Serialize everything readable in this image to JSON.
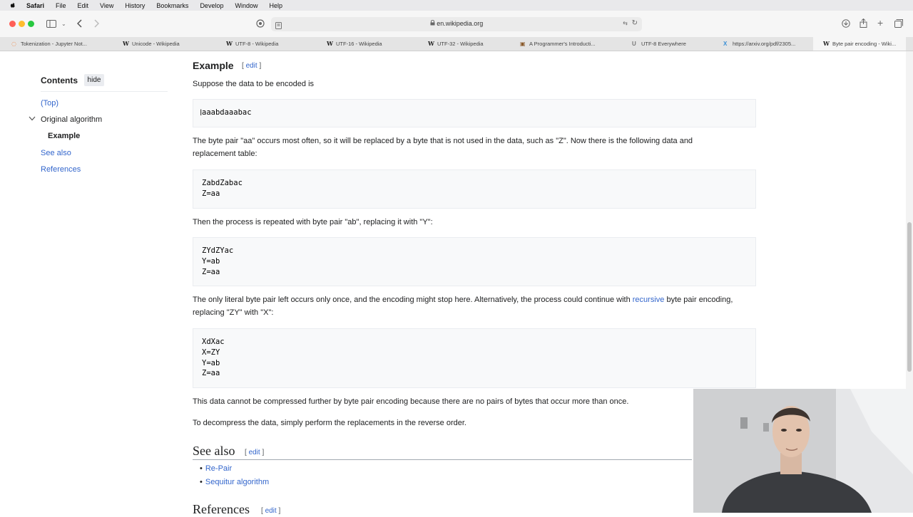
{
  "menubar": {
    "app": "Safari",
    "items": [
      "File",
      "Edit",
      "View",
      "History",
      "Bookmarks",
      "Develop",
      "Window",
      "Help"
    ]
  },
  "toolbar": {
    "address": "en.wikipedia.org"
  },
  "tabs": [
    {
      "label": "Tokenization - Jupyter Not...",
      "icon": "jupyter-icon"
    },
    {
      "label": "Unicode - Wikipedia",
      "icon": "wikipedia-icon"
    },
    {
      "label": "UTF-8 - Wikipedia",
      "icon": "wikipedia-icon"
    },
    {
      "label": "UTF-16 - Wikipedia",
      "icon": "wikipedia-icon"
    },
    {
      "label": "UTF-32 - Wikipedia",
      "icon": "wikipedia-icon"
    },
    {
      "label": "A Programmer's Introducti...",
      "icon": "image-icon"
    },
    {
      "label": "UTF-8 Everywhere",
      "icon": "u-icon"
    },
    {
      "label": "https://arxiv.org/pdf/2305...",
      "icon": "arxiv-icon"
    },
    {
      "label": "Byte pair encoding - Wiki...",
      "icon": "wikipedia-icon",
      "active": true
    }
  ],
  "toc": {
    "title": "Contents",
    "hide": "hide",
    "items": [
      "(Top)",
      "Original algorithm",
      "Example",
      "See also",
      "References"
    ]
  },
  "article": {
    "example_heading": "Example",
    "edit": "edit",
    "intro": "Suppose the data to be encoded is",
    "code1": "aaabdaaabac",
    "para2": "The byte pair \"aa\" occurs most often, so it will be replaced by a byte that is not used in the data, such as \"Z\". Now there is the following data and replacement table:",
    "code2": "ZabdZabac\nZ=aa",
    "para3": "Then the process is repeated with byte pair \"ab\", replacing it with \"Y\":",
    "code3": "ZYdZYac\nY=ab\nZ=aa",
    "para4_a": "The only literal byte pair left occurs only once, and the encoding might stop here. Alternatively, the process could continue with ",
    "para4_link": "recursive",
    "para4_b": " byte pair encoding, replacing \"ZY\" with \"X\":",
    "code4": "XdXac\nX=ZY\nY=ab\nZ=aa",
    "para5": "This data cannot be compressed further by byte pair encoding because there are no pairs of bytes that occur more than once.",
    "para6": "To decompress the data, simply perform the replacements in the reverse order.",
    "see_also_heading": "See also",
    "see_also": [
      "Re-Pair",
      "Sequitur algorithm"
    ],
    "references_heading": "References"
  },
  "colors": {
    "link": "#3366cc",
    "close": "#ff5f57",
    "minimize": "#febc2e",
    "zoom": "#28c840"
  }
}
